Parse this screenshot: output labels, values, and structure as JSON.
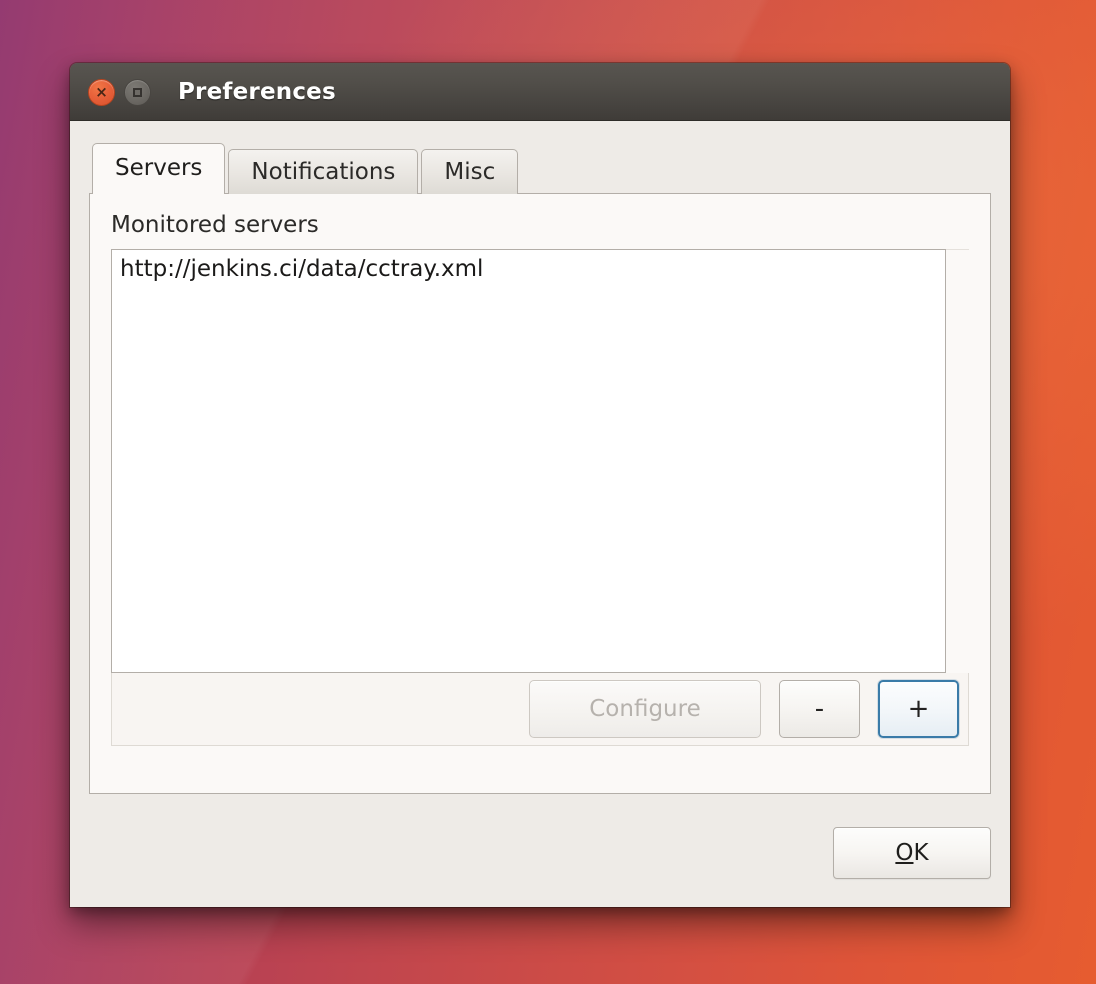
{
  "desktop": {
    "wallpaper_colors": [
      "#8e3069",
      "#c5484b",
      "#e65c30"
    ]
  },
  "window": {
    "title": "Preferences",
    "controls": {
      "close_icon": "close-icon",
      "close_glyph": "×",
      "maximize_icon": "maximize-icon",
      "close_color": "#e8613a",
      "maximize_color": "#6e6b66"
    },
    "titlebar_color": "#4a4743",
    "body_color": "#eeebe7"
  },
  "tabs": [
    {
      "label": "Servers",
      "active": true
    },
    {
      "label": "Notifications",
      "active": false
    },
    {
      "label": "Misc",
      "active": false
    }
  ],
  "servers_tab": {
    "label": "Monitored servers",
    "list": [
      {
        "url": "http://jenkins.ci/data/cctray.xml",
        "selected": false
      }
    ],
    "toolbar": {
      "configure_label": "Configure",
      "configure_enabled": false,
      "remove_label": "-",
      "add_label": "+",
      "add_focused": true,
      "focus_color": "#3a7ba8"
    }
  },
  "actions": {
    "ok_mnemonic": "O",
    "ok_rest": "K"
  }
}
